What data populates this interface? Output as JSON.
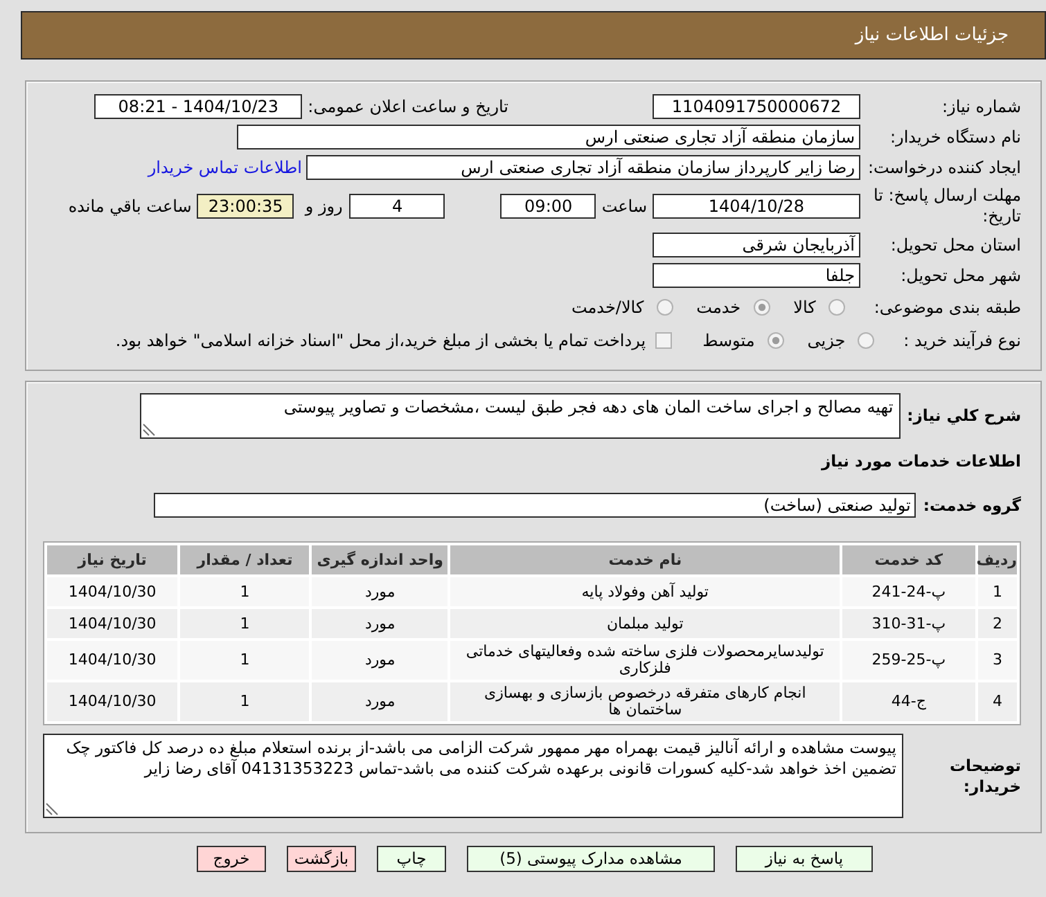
{
  "header": {
    "title": "جزئیات اطلاعات نیاز"
  },
  "details": {
    "need_number": {
      "label": "شماره نیاز:",
      "value": "1104091750000672"
    },
    "announcement": {
      "label": "تاریخ و ساعت اعلان عمومی:",
      "value": "1404/10/23 - 08:21"
    },
    "buyer_org": {
      "label": "نام دستگاه خریدار:",
      "value": "سازمان منطقه آزاد تجاری صنعتی ارس"
    },
    "requester": {
      "label": "ایجاد کننده درخواست:",
      "value": "رضا زایر کارپرداز سازمان منطقه آزاد تجاری صنعتی ارس",
      "link": "اطلاعات تماس خریدار"
    },
    "deadline": {
      "label": "مهلت ارسال پاسخ: تا تاریخ:",
      "date": "1404/10/28",
      "time_label": "ساعت",
      "time": "09:00",
      "days": "4",
      "days_label": "روز و",
      "remaining": "23:00:35",
      "remaining_label": "ساعت باقي مانده"
    },
    "province": {
      "label": "استان محل تحویل:",
      "value": "آذربایجان شرقی"
    },
    "city": {
      "label": "شهر محل تحویل:",
      "value": "جلفا"
    },
    "category": {
      "label": "طبقه بندی موضوعی:",
      "options": [
        {
          "label": "کالا",
          "selected": false
        },
        {
          "label": "خدمت",
          "selected": true
        },
        {
          "label": "کالا/خدمت",
          "selected": false
        }
      ]
    },
    "purchase_type": {
      "label": "نوع فرآیند خرید :",
      "options": [
        {
          "label": "جزیی",
          "selected": false
        },
        {
          "label": "متوسط",
          "selected": true
        }
      ],
      "treasury_payment": {
        "label": "پرداخت تمام یا بخشی از مبلغ خرید،از محل \"اسناد خزانه اسلامی\" خواهد بود.",
        "checked": false
      }
    }
  },
  "services": {
    "description": {
      "label": "شرح کلي نیاز:",
      "value": "تهیه مصالح و اجرای ساخت المان های دهه فجر طبق لیست ،مشخصات و تصاویر پیوستی"
    },
    "section_title": "اطلاعات خدمات مورد نیاز",
    "service_group": {
      "label": "گروه خدمت:",
      "value": "تولید صنعتی (ساخت)"
    },
    "table": {
      "columns": [
        "ردیف",
        "کد خدمت",
        "نام خدمت",
        "واحد اندازه گیری",
        "تعداد / مقدار",
        "تاریخ نیاز"
      ],
      "rows": [
        [
          "1",
          "پ-24-241",
          "تولید آهن وفولاد پایه",
          "مورد",
          "1",
          "1404/10/30"
        ],
        [
          "2",
          "پ-31-310",
          "تولید مبلمان",
          "مورد",
          "1",
          "1404/10/30"
        ],
        [
          "3",
          "پ-25-259",
          "تولیدسایرمحصولات فلزی ساخته شده وفعالیتهای خدماتی فلزکاری",
          "مورد",
          "1",
          "1404/10/30"
        ],
        [
          "4",
          "ج-44",
          "انجام کارهای متفرقه درخصوص بازسازی و بهسازی ساختمان ها",
          "مورد",
          "1",
          "1404/10/30"
        ]
      ]
    },
    "buyer_notes": {
      "label": "توضیحات خریدار:",
      "value": "پیوست مشاهده و ارائه آنالیز قیمت بهمراه مهر ممهور شرکت الزامی می باشد-از برنده استعلام مبلغ ده درصد کل فاکتور چک تضمین اخذ خواهد شد-کلیه کسورات قانونی برعهده شرکت کننده می باشد-تماس 04131353223 آقای رضا زایر"
    }
  },
  "buttons": [
    {
      "label": "پاسخ به نیاز",
      "kind": "action"
    },
    {
      "label": "مشاهده مدارک پیوستی (5)",
      "kind": "action"
    },
    {
      "label": "چاپ",
      "kind": "action"
    },
    {
      "label": "بازگشت",
      "kind": "exit"
    },
    {
      "label": "خروج",
      "kind": "exit"
    }
  ]
}
